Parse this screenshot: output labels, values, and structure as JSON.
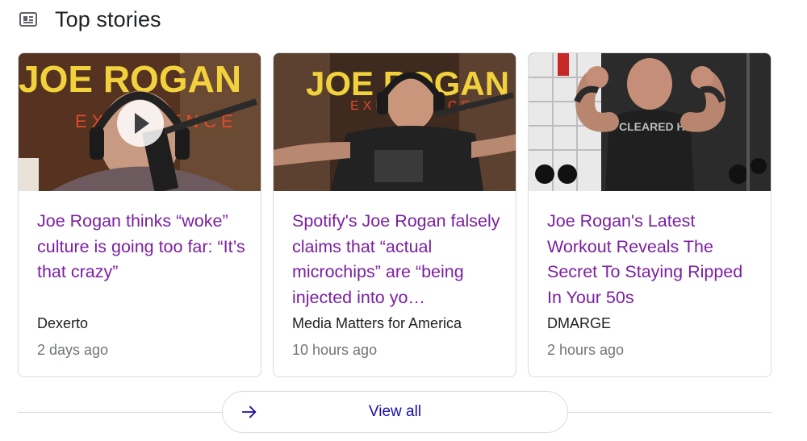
{
  "section": {
    "title": "Top stories",
    "icon": "news-icon"
  },
  "stories": [
    {
      "headline": "Joe Rogan thinks “woke” culture is going too far: “It’s that crazy”",
      "source": "Dexerto",
      "time": "2 days ago",
      "has_video": true,
      "thumb_text": "JOE ROGAN"
    },
    {
      "headline": "Spotify's Joe Rogan falsely claims that “actual microchips” are “being injected into yo…",
      "source": "Media Matters for America",
      "time": "10 hours ago",
      "has_video": false,
      "thumb_text": "JOE ROGAN"
    },
    {
      "headline": "Joe Rogan's Latest Workout Reveals The Secret To Staying Ripped In Your 50s",
      "source": "DMARGE",
      "time": "2 hours ago",
      "has_video": false,
      "thumb_text": "CLEARED HOT"
    }
  ],
  "view_all": {
    "label": "View all",
    "icon": "arrow-right-icon"
  },
  "colors": {
    "headline": "#7b1fa2",
    "link": "#1a0dab",
    "meta": "#70757a",
    "border": "#dadce0"
  }
}
